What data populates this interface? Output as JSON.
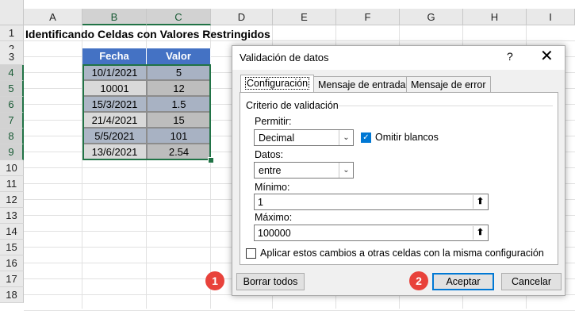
{
  "sheet": {
    "columns": [
      "A",
      "B",
      "C",
      "D",
      "E",
      "F",
      "G",
      "H",
      "I"
    ],
    "rows": [
      "1",
      "2",
      "3",
      "4",
      "5",
      "6",
      "7",
      "8",
      "9",
      "10",
      "11",
      "12",
      "13",
      "14",
      "15",
      "16",
      "17",
      "18"
    ],
    "title": "Identificando Celdas con Valores Restringidos",
    "table": {
      "headers": [
        "Fecha",
        "Valor"
      ],
      "rows": [
        [
          "10/1/2021",
          "5"
        ],
        [
          "10001",
          "12"
        ],
        [
          "15/3/2021",
          "1.5"
        ],
        [
          "21/4/2021",
          "15"
        ],
        [
          "5/5/2021",
          "101"
        ],
        [
          "13/6/2021",
          "2.54"
        ]
      ]
    },
    "colors": {
      "header": "#4472c4",
      "selection": "#217346"
    }
  },
  "dialog": {
    "title": "Validación de datos",
    "help": "?",
    "close": "✕",
    "tabs": [
      "Configuración",
      "Mensaje de entrada",
      "Mensaje de error"
    ],
    "group_label": "Criterio de validación",
    "allow_label": "Permitir:",
    "allow_value": "Decimal",
    "ignore_blank_label": "Omitir blancos",
    "ignore_blank_checked": true,
    "data_label": "Datos:",
    "data_value": "entre",
    "min_label": "Mínimo:",
    "min_value": "1",
    "max_label": "Máximo:",
    "max_value": "100000",
    "apply_label": "Aplicar estos cambios a otras celdas con la misma configuración",
    "apply_checked": false,
    "clear_all": "Borrar todos",
    "ok": "Aceptar",
    "cancel": "Cancelar"
  },
  "badges": [
    "1",
    "2"
  ],
  "badge_color": "#e8423b"
}
